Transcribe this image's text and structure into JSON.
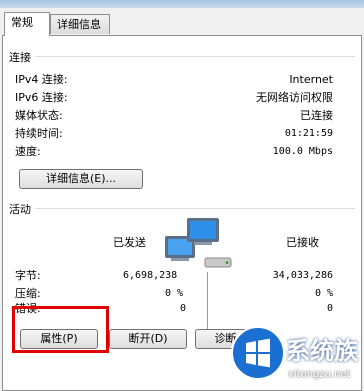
{
  "tabs": [
    {
      "label": "常规"
    },
    {
      "label": "详细信息"
    }
  ],
  "connection": {
    "title": "连接",
    "rows": [
      {
        "label": "IPv4 连接:",
        "value": "Internet"
      },
      {
        "label": "IPv6 连接:",
        "value": "无网络访问权限"
      },
      {
        "label": "媒体状态:",
        "value": "已连接"
      },
      {
        "label": "持续时间:",
        "value": "01:21:59"
      },
      {
        "label": "速度:",
        "value": "100.0 Mbps"
      }
    ],
    "details_button": "详细信息(E)..."
  },
  "activity": {
    "title": "活动",
    "sent_label": "已发送",
    "received_label": "已接收",
    "rows": [
      {
        "label": "字节:",
        "sent": "6,698,238",
        "received": "34,033,286"
      },
      {
        "label": "压缩:",
        "sent": "0 %",
        "received": "0 %"
      },
      {
        "label": "错误:",
        "sent": "0",
        "received": "0"
      }
    ]
  },
  "buttons": {
    "properties": "属性(P)",
    "disable": "断开(D)",
    "diagnose": "诊断(G)"
  },
  "watermark": {
    "brand": "系统族",
    "domain": "xitongzu.net"
  },
  "colors": {
    "accent": "#3399ff",
    "highlight": "#e00000"
  }
}
